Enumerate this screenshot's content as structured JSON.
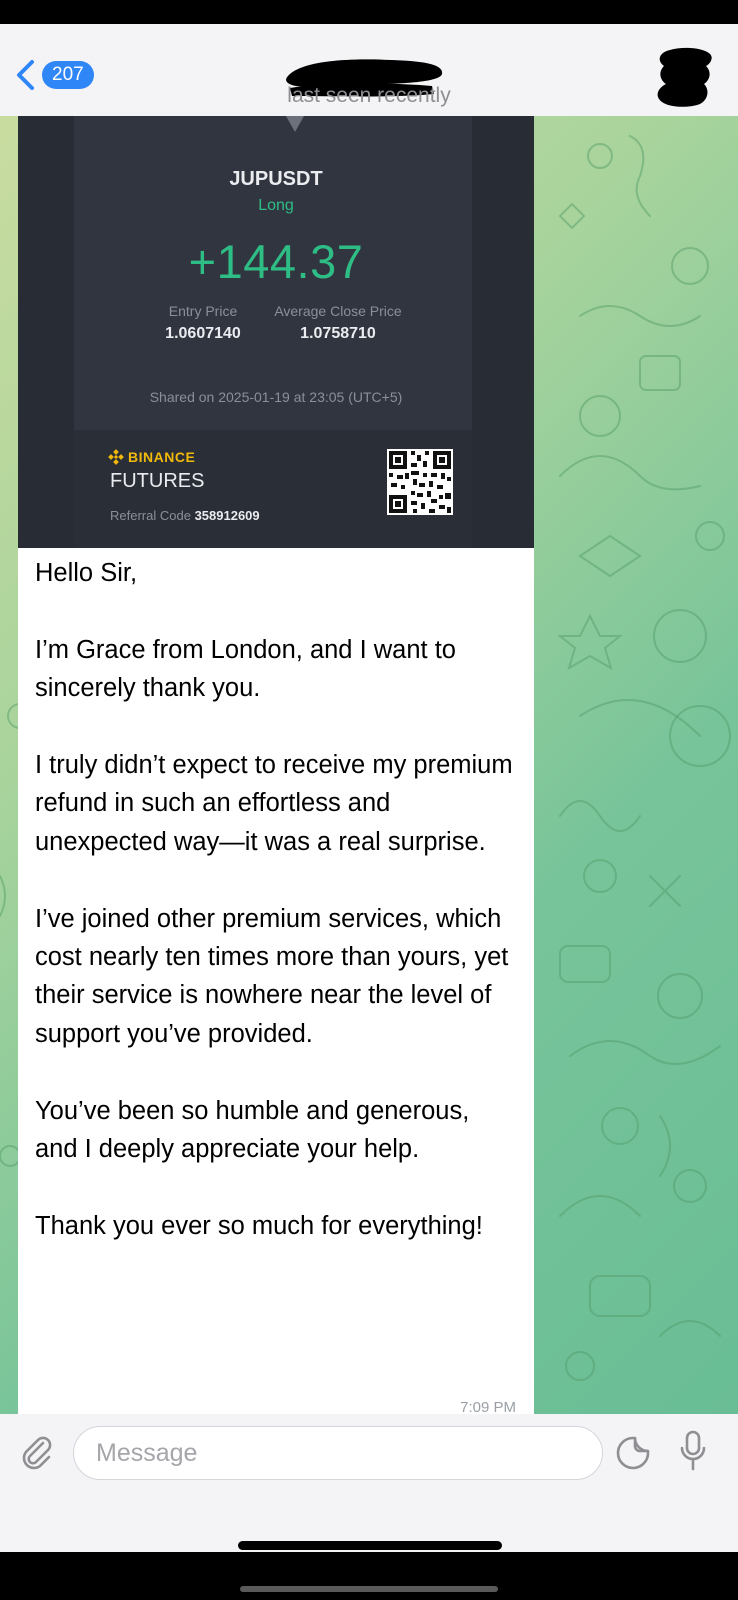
{
  "header": {
    "unread_count": "207",
    "status": "last seen recently"
  },
  "shared_card": {
    "symbol": "JUPUSDT",
    "side": "Long",
    "pnl": "+144.37",
    "entry_price_label": "Entry Price",
    "entry_price": "1.0607140",
    "avg_close_label": "Average Close Price",
    "avg_close_price": "1.0758710",
    "shared_on": "Shared on 2025-01-19 at 23:05 (UTC+5)",
    "brand": "BINANCE",
    "product": "FUTURES",
    "referral_label": "Referral Code",
    "referral_code": "358912609"
  },
  "message": {
    "paragraphs": [
      "Hello Sir,",
      "I’m Grace from London, and I want to sincerely thank you.",
      "I truly didn’t expect to receive my premium refund in such an effortless and unexpected way—it was a real surprise.",
      "I’ve joined other premium services, which cost nearly ten times more than yours, yet their service is nowhere near the level of support you’ve provided.",
      "You’ve been so humble and generous, and I deeply appreciate your help.",
      "Thank you ever so much for everything!"
    ],
    "time": "7:09 PM"
  },
  "input": {
    "placeholder": "Message"
  },
  "colors": {
    "accent_blue": "#2f86f6",
    "profit_green": "#2ebd85",
    "binance_yellow": "#f0b90b",
    "card_bg": "#282c35"
  }
}
